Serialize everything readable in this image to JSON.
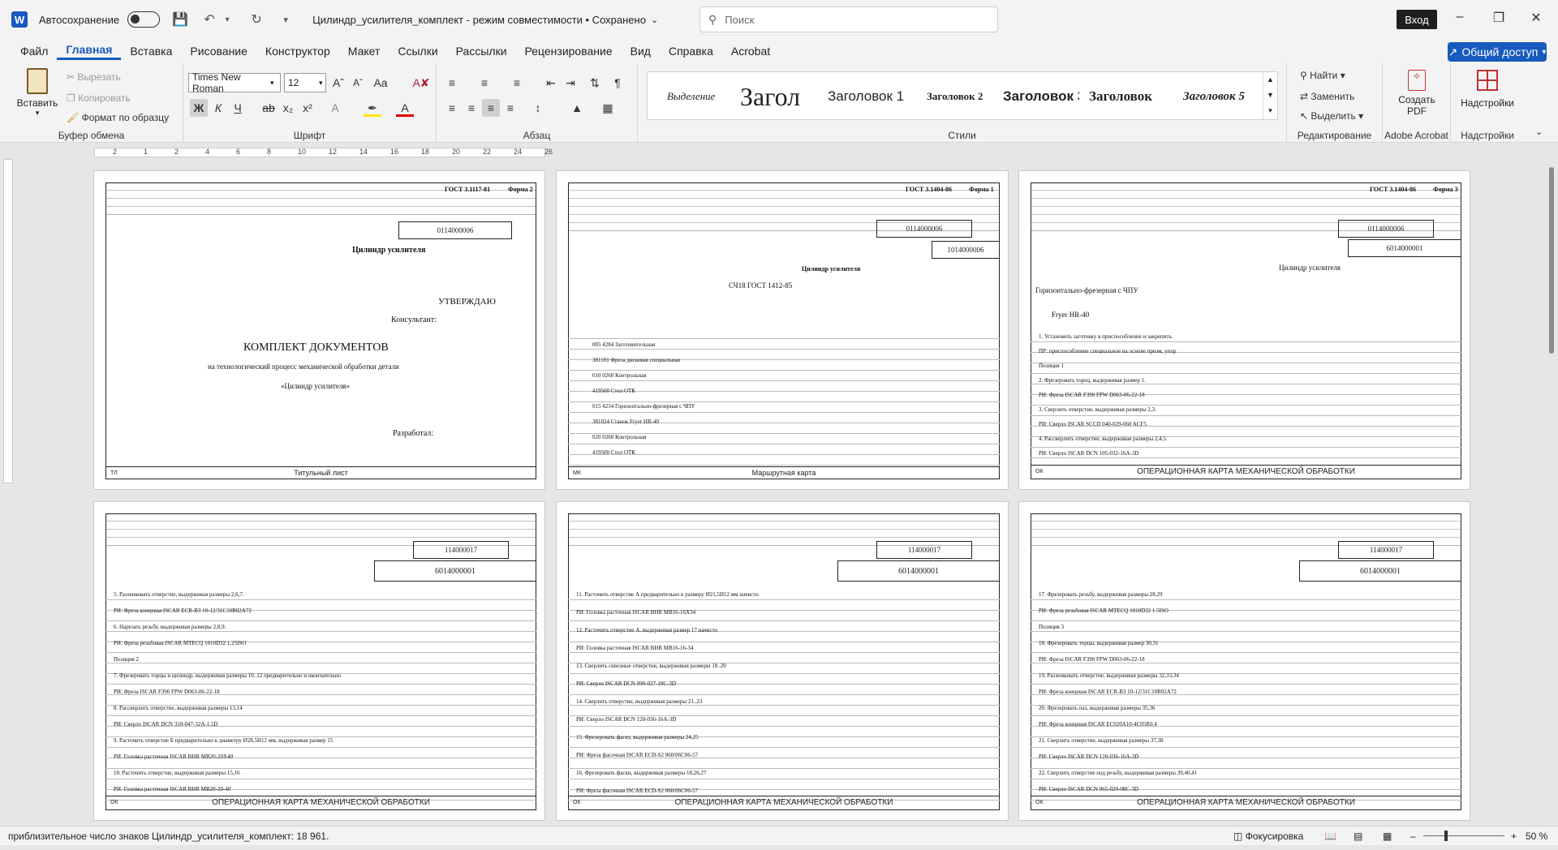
{
  "titlebar": {
    "autosave_label": "Автосохранение",
    "doc_title": "Цилиндр_усилителя_комплект  -  режим совместимости  •  Сохранено",
    "search_placeholder": "Поиск",
    "signin_label": "Вход"
  },
  "menu": {
    "tabs": [
      "Файл",
      "Главная",
      "Вставка",
      "Рисование",
      "Конструктор",
      "Макет",
      "Ссылки",
      "Рассылки",
      "Рецензирование",
      "Вид",
      "Справка",
      "Acrobat"
    ],
    "active_index": 1,
    "share_label": "Общий доступ"
  },
  "ribbon": {
    "clipboard": {
      "paste": "Вставить",
      "cut": "Вырезать",
      "copy": "Копировать",
      "format_painter": "Формат по образцу",
      "label": "Буфер обмена"
    },
    "font": {
      "family": "Times New Roman",
      "size": "12",
      "bold": "Ж",
      "italic": "К",
      "underline": "Ч",
      "label": "Шрифт"
    },
    "paragraph": {
      "label": "Абзац"
    },
    "styles": {
      "items": [
        "Выделение",
        "Загол",
        "Заголовок 1",
        "Заголовок 2",
        "Заголовок 3",
        "Заголовок",
        "Заголовок 5"
      ],
      "label": "Стили"
    },
    "editing": {
      "find": "Найти",
      "replace": "Заменить",
      "select": "Выделить",
      "label": "Редактирование"
    },
    "acrobat": {
      "create_pdf": "Создать PDF",
      "label": "Adobe Acrobat"
    },
    "addins": {
      "button": "Надстройки",
      "label": "Надстройки"
    }
  },
  "ruler": {
    "ticks": [
      "2",
      "1",
      "2",
      "4",
      "6",
      "8",
      "10",
      "12",
      "14",
      "16",
      "18",
      "20",
      "22",
      "24",
      "26"
    ]
  },
  "pages": {
    "p1": {
      "gost": "ГОСТ 3.1117-81",
      "form": "Форма 2",
      "code": "0114000006",
      "product": "Цилиндр усилителя",
      "approve": "УТВЕРЖДАЮ",
      "consultant": "Консультант:",
      "title": "КОМПЛЕКТ ДОКУМЕНТОВ",
      "subtitle": "на технологический процесс механической обработки детали",
      "part": "«Цилиндр усилителя»",
      "developer": "Разработал:",
      "caption": "Титульный лист",
      "caption_code": "ТЛ"
    },
    "p2": {
      "gost": "ГОСТ 3.1404-86",
      "form": "Форма 1",
      "code": "0114000006",
      "code2": "1014000006",
      "product": "Цилиндр усилителя",
      "material": "СЧ18 ГОСТ 1412-85",
      "rows": [
        "005  4284  Заготовительная",
        "381101  Фреза дисковая специальная",
        "010  0260  Контрольная",
        "419500  Стол ОТК",
        "015  4234  Горизонтально-фрезерная с ЧПУ",
        "381024  Станок Fryer HR-40",
        "020  0260  Контрольная",
        "419500  Стол ОТК"
      ],
      "caption": "Маршрутная карта",
      "caption_code": "МК"
    },
    "p3": {
      "gost": "ГОСТ 3.1404-86",
      "form": "Форма 3",
      "code": "0114000006",
      "code2": "6014000001",
      "product": "Цилиндр усилителя",
      "operation": "Горизонтально-фрезерная с ЧПУ",
      "machine": "Fryer HR-40",
      "rows": [
        "1. Установить заготовку в приспособление и закрепить.",
        "ПР: приспособление специальное на основе призм, упор",
        "Позиция 1",
        "2. Фрезеровать торец, выдерживая размер 1.",
        "РИ: Фреза ISCAR F390 FPW D063-06-22-18",
        "3. Сверлить отверстие, выдерживая размеры 2,3.",
        "РИ: Сверло ISCAR SCCD 040-029-060 ACF5",
        "4. Рассверлить отверстие, выдерживая размеры 2,4,5.",
        "РИ: Сверло ISCAR DCN 105-032-16A-3D"
      ],
      "caption": "ОПЕРАЦИОННАЯ КАРТА МЕХАНИЧЕСКОЙ ОБРАБОТКИ",
      "caption_code": "ОК"
    },
    "p4": {
      "code": "114000017",
      "code2": "6014000001",
      "rows": [
        "5. Раззенковать отверстие, выдерживая размеры 2,6,7.",
        "РИ: Фреза концевая ISCAR ECR-B3 10-12/31C10R02A72",
        "6. Нарезать резьбу, выдерживая размеры 2,8,9.",
        "РИ: Фреза резьбовая ISCAR MTECQ 1010D32 1.25ISO",
        "Позиция 2",
        "7. Фрезеровать торцы и цилиндр, выдерживая размеры 10..12 предварительно и окончательно",
        "РИ: Фреза ISCAR F390 FPW D063-06-22-18",
        "8. Рассверлить отверстие, выдерживая размеры 13,14",
        "РИ: Сверло ISCAR DCN 310-047-32A-1.5D",
        "9. Расточить отверстие Б предварительно к диаметру Ø28,5Н12 мм, выдерживая размер 15",
        "РИ: Головка расточная ISCAR BHR MB20-20X40",
        "10. Расточить отверстие, выдерживая размеры 15,16",
        "РИ: Головка расточная ISCAR BHR MB20-20-40"
      ],
      "caption": "ОПЕРАЦИОННАЯ КАРТА МЕХАНИЧЕСКОЙ ОБРАБОТКИ",
      "caption_code": "ОК"
    },
    "p5": {
      "code": "114000017",
      "code2": "6014000001",
      "rows": [
        "11. Расточить отверстие А предварительно к размеру Ø21,5Н12 мм начисто",
        "РИ: Головка расточная ISCAR BHR MB16-16X34",
        "12. Расточить отверстие А, выдерживая размер 17 начисто",
        "РИ: Головка расточная ISCAR BHR MB16-16-34",
        "13. Сверлить сквозные отверстия, выдерживая размеры 18..20",
        "РИ: Сверло ISCAR DCN 090-027-10C-3D",
        "14. Сверлить отверстие, выдерживая размеры 21..23",
        "РИ: Сверло ISCAR DCN 120-036-16A-3D",
        "15. Фрезеровать фаску, выдерживая размеры 24,25",
        "РИ: Фреза фасочная ISCAR ECD-S2 060/06C06-57",
        "16. Фрезеровать фаски, выдерживая размеры 18,26,27",
        "РИ: Фреза фасочная ISCAR ECD-S2 060/06C06-57"
      ],
      "caption": "ОПЕРАЦИОННАЯ КАРТА МЕХАНИЧЕСКОЙ ОБРАБОТКИ",
      "caption_code": "ОК"
    },
    "p6": {
      "code": "114000017",
      "code2": "6014000001",
      "rows": [
        "17. Фрезеровать резьбу, выдерживая размеры 28,29",
        "РИ: Фреза резьбовая ISCAR MTECQ 1010D32 1.5ISO",
        "Позиция 3",
        "18. Фрезеровать торцы, выдерживая размер 30,31",
        "РИ: Фреза ISCAR F390 FPW D063-06-22-18",
        "19. Раззенковать отверстие, выдерживая размеры 32,33,34",
        "РИ: Фреза концевая ISCAR ECR-B3 10-12/31C10R02A72",
        "20. Фрезеровать паз, выдерживая размеры 35,36",
        "РИ: Фреза концевая ISCAR EC020A10-4C05R0.4",
        "21. Сверлить отверстие, выдерживая размеры 37,38",
        "РИ: Сверло ISCAR DCN 120-036-16A-3D",
        "22. Сверлить отверстие под резьбу, выдерживая размеры 39,40,41",
        "РИ: Сверло ISCAR DCN 065-020-08C-3D"
      ],
      "caption": "ОПЕРАЦИОННАЯ КАРТА МЕХАНИЧЕСКОЙ ОБРАБОТКИ",
      "caption_code": "ОК"
    }
  },
  "statusbar": {
    "word_count": "приблизительное число знаков Цилиндр_усилителя_комплект: 18 961.",
    "focus": "Фокусировка",
    "zoom": "50 %"
  }
}
